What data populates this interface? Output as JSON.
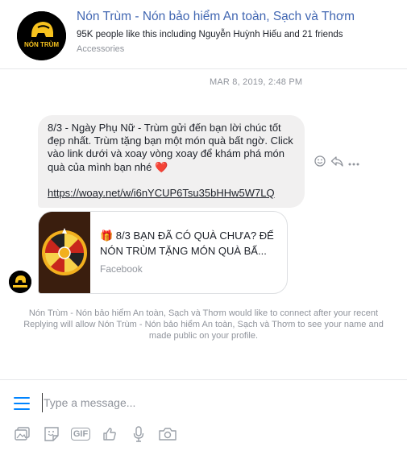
{
  "header": {
    "page_name": "Nón Trùm - Nón bảo hiểm An toàn, Sạch và Thơm",
    "likes": "95K people like this including Nguyễn Huỳnh Hiếu and 21 friends",
    "category": "Accessories",
    "logo_text": "NÓN TRÙM",
    "logo_icon": "helmet-logo"
  },
  "timestamp": "MAR 8, 2019, 2:48 PM",
  "message": {
    "text": "8/3 - Ngày Phụ Nữ - Trùm gửi đến bạn lời chúc tốt đẹp nhất. Trùm tặng bạn một món quà bất ngờ. Click vào link dưới và xoay vòng xoay để khám phá món quà của mình bạn nhé ",
    "heart": "❤️",
    "link": "https://woay.net/w/i6nYCUP6Tsu35bHHw5W7LQ",
    "bubble_color": "#f1f0f0"
  },
  "message_actions": {
    "react_icon": "smiley-icon",
    "share_icon": "share-icon",
    "more_icon": "more-icon"
  },
  "link_card": {
    "title": "🎁 8/3 BẠN ĐÃ CÓ QUÀ CHƯA? ĐẾ NÓN TRÙM TẶNG MÓN QUÀ BẤ...",
    "source": "Facebook"
  },
  "notice": {
    "line1": "Nón Trùm - Nón bảo hiểm An toàn, Sạch và Thơm would like to connect after your recent",
    "line2": "Replying will allow Nón Trùm - Nón bảo hiểm An toàn, Sạch và Thơm to see your name and",
    "line3": "made public on your profile."
  },
  "composer": {
    "placeholder": "Type a message...",
    "value": "",
    "tools": [
      "image-icon",
      "sticker-icon",
      "gif-icon",
      "thumbs-up-icon",
      "microphone-icon",
      "camera-icon"
    ],
    "gif_label": "GIF"
  },
  "colors": {
    "accent": "#0084ff",
    "link_blue": "#4267b2",
    "muted": "#90949c"
  }
}
